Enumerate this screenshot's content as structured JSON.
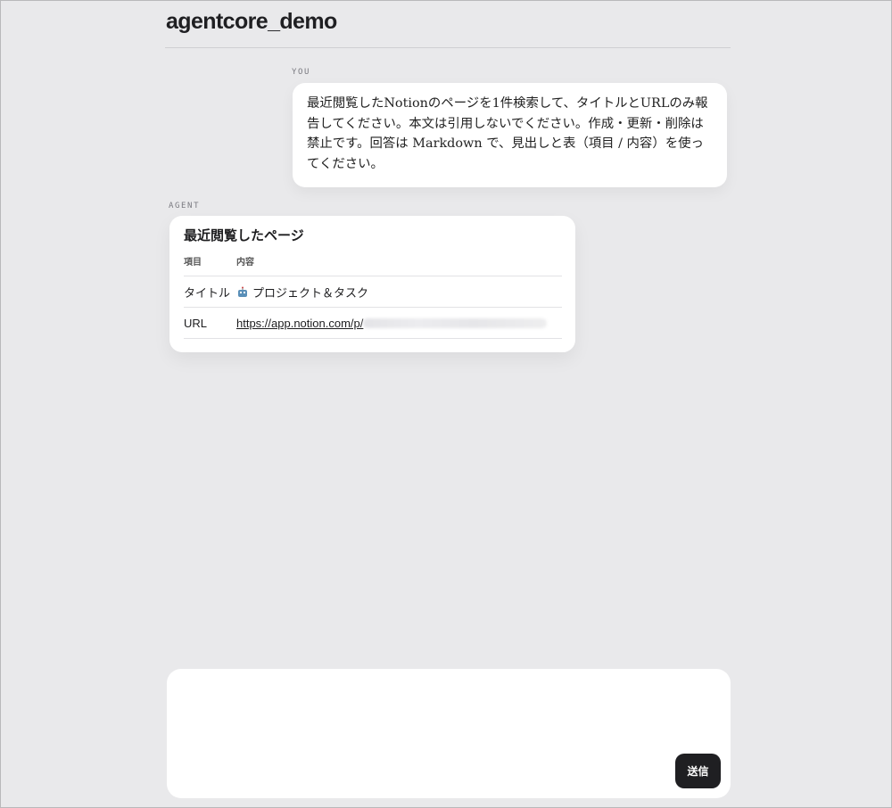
{
  "app": {
    "title": "agentcore_demo"
  },
  "conversation": {
    "user": {
      "role_label": "YOU",
      "text": "最近閲覧したNotionのページを1件検索して、タイトルとURLのみ報告してください。本文は引用しないでください。作成・更新・削除は禁止です。回答は Markdown で、見出しと表（項目 / 内容）を使ってください。"
    },
    "agent": {
      "role_label": "AGENT",
      "heading": "最近閲覧したページ",
      "table": {
        "headers": [
          "項目",
          "内容"
        ],
        "rows": [
          {
            "label": "タイトル",
            "value": "プロジェクト＆タスク",
            "icon": "robot-icon"
          },
          {
            "label": "URL",
            "value": "https://app.notion.com/p/",
            "redacted": true
          }
        ]
      }
    }
  },
  "composer": {
    "send_label": "送信"
  }
}
